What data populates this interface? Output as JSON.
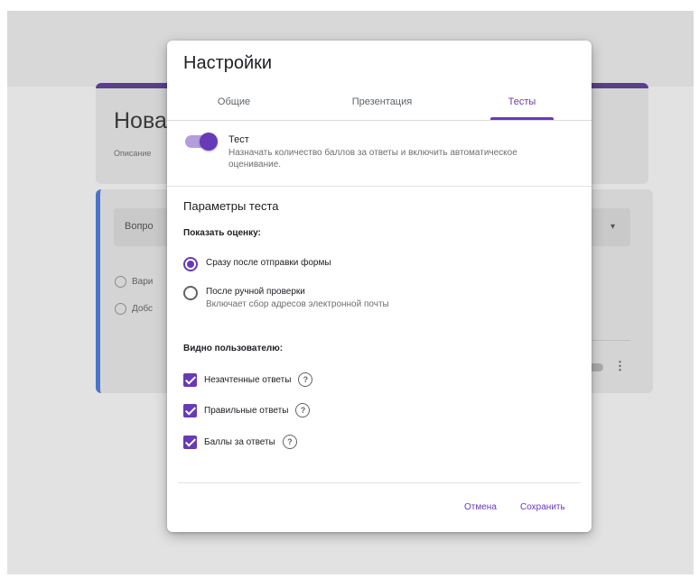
{
  "background": {
    "form_title": "Нова",
    "form_description": "Описание",
    "question_placeholder": "Вопро",
    "option_1": "Вари",
    "option_2": "Добс",
    "caret": "▾",
    "more": "⋮"
  },
  "dialog": {
    "title": "Настройки",
    "tabs": [
      {
        "label": "Общие",
        "active": false
      },
      {
        "label": "Презентация",
        "active": false
      },
      {
        "label": "Тесты",
        "active": true
      }
    ],
    "quiz": {
      "toggle_on": true,
      "title": "Тест",
      "description": "Назначать количество баллов за ответы и включить автоматическое оценивание."
    },
    "section_title": "Параметры теста",
    "show_score": {
      "label": "Показать оценку:",
      "options": [
        {
          "label": "Сразу после отправки формы",
          "sub": "",
          "checked": true
        },
        {
          "label": "После ручной проверки",
          "sub": "Включает сбор адресов электронной почты",
          "checked": false
        }
      ]
    },
    "visible_to_user": {
      "label": "Видно пользователю:",
      "items": [
        {
          "label": "Незачтенные ответы",
          "checked": true
        },
        {
          "label": "Правильные ответы",
          "checked": true
        },
        {
          "label": "Баллы за ответы",
          "checked": true
        }
      ],
      "help_glyph": "?"
    },
    "buttons": {
      "cancel": "Отмена",
      "save": "Сохранить"
    }
  },
  "colors": {
    "accent": "#673ab7",
    "accent_light": "#b39ddb",
    "text": "#202124",
    "secondary_text": "#6f6f6f"
  },
  "icons": {
    "help": "help-circle-icon",
    "more": "more-vert-icon",
    "dropdown": "arrow-drop-down-icon"
  }
}
